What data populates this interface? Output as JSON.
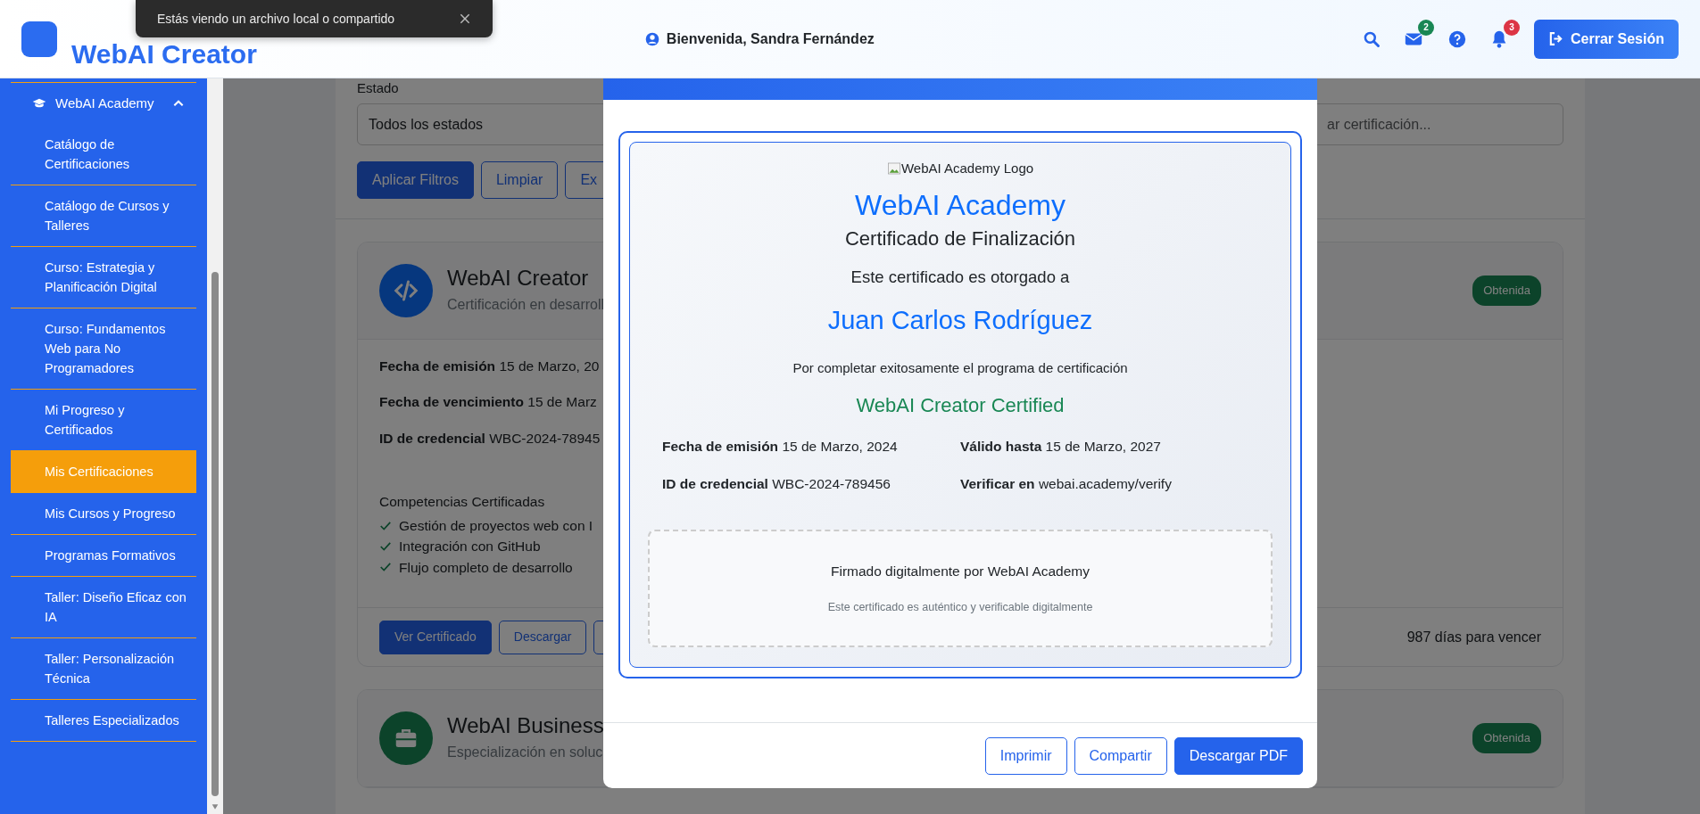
{
  "toast": {
    "message": "Estás viendo un archivo local o compartido"
  },
  "header": {
    "brand": "WebAI Creator",
    "welcome": "Bienvenida, Sandra Fernández",
    "message_count": "2",
    "notification_count": "3",
    "logout": "Cerrar Sesión"
  },
  "sidebar": {
    "section": {
      "label": "WebAI Academy",
      "expanded": true
    },
    "items": [
      {
        "label": "Catálogo de Certificaciones",
        "selected": false
      },
      {
        "label": "Catálogo de Cursos y Talleres",
        "selected": false
      },
      {
        "label": "Curso: Estrategia y Planificación Digital",
        "selected": false
      },
      {
        "label": "Curso: Fundamentos Web para No Programadores",
        "selected": false
      },
      {
        "label": "Mi Progreso y Certificados",
        "selected": false
      },
      {
        "label": "Mis Certificaciones",
        "selected": true
      },
      {
        "label": "Mis Cursos y Progreso",
        "selected": false
      },
      {
        "label": "Programas Formativos",
        "selected": false
      },
      {
        "label": "Taller: Diseño Eficaz con IA",
        "selected": false
      },
      {
        "label": "Taller: Personalización Técnica",
        "selected": false
      },
      {
        "label": "Talleres Especializados",
        "selected": false
      }
    ]
  },
  "filters": {
    "status_label": "Estado",
    "status_value": "Todos los estados",
    "search_placeholder": "ar certificación...",
    "buttons": [
      {
        "label": "Aplicar Filtros",
        "kind": "primary"
      },
      {
        "label": "Limpiar",
        "kind": "outline"
      },
      {
        "label": "Ex",
        "kind": "outline"
      }
    ]
  },
  "certifications": [
    {
      "kind": "code",
      "title": "WebAI Creator",
      "subtitle": "Certificación en desarroll",
      "status": "Obtenida",
      "details": [
        {
          "label": "Fecha de emisión",
          "value": "15 de Marzo, 20"
        },
        {
          "label": "Fecha de vencimiento",
          "value": "15 de Marz"
        },
        {
          "label": "ID de credencial",
          "value": "WBC-2024-78945"
        }
      ],
      "skills_title": "Competencias Certificadas",
      "skills": [
        "Gestión de proyectos web con I",
        "Integración con GitHub",
        "Flujo completo de desarrollo"
      ],
      "buttons": [
        {
          "label": "Ver Certificado",
          "kind": "primary"
        },
        {
          "label": "Descargar",
          "kind": "outline"
        },
        {
          "kind": "outline"
        }
      ],
      "expiry": "987 días para vencer"
    },
    {
      "kind": "business",
      "title": "WebAI Business",
      "subtitle": "Especialización en soluc",
      "status": "Obtenida"
    }
  ],
  "modal": {
    "certificate": {
      "logo_alt": "WebAI Academy Logo",
      "issuer": "WebAI Academy",
      "title": "Certificado de Finalización",
      "awarded_to": "Este certificado es otorgado a",
      "recipient": "Juan Carlos Rodríguez",
      "reason": "Por completar exitosamente el programa de certificación",
      "program": "WebAI Creator Certified",
      "details": [
        {
          "label": "Fecha de emisión",
          "value": "15 de Marzo, 2024"
        },
        {
          "label": "Válido hasta",
          "value": "15 de Marzo, 2027"
        },
        {
          "label": "ID de credencial",
          "value": "WBC-2024-789456"
        },
        {
          "label": "Verificar en",
          "value": "webai.academy/verify"
        }
      ],
      "signature": "Firmado digitalmente por WebAI Academy",
      "signature_note": "Este certificado es auténtico y verificable digitalmente"
    },
    "buttons": [
      {
        "label": "Imprimir",
        "kind": "outline"
      },
      {
        "label": "Compartir",
        "kind": "outline"
      },
      {
        "label": "Descargar PDF",
        "kind": "primary"
      }
    ]
  }
}
